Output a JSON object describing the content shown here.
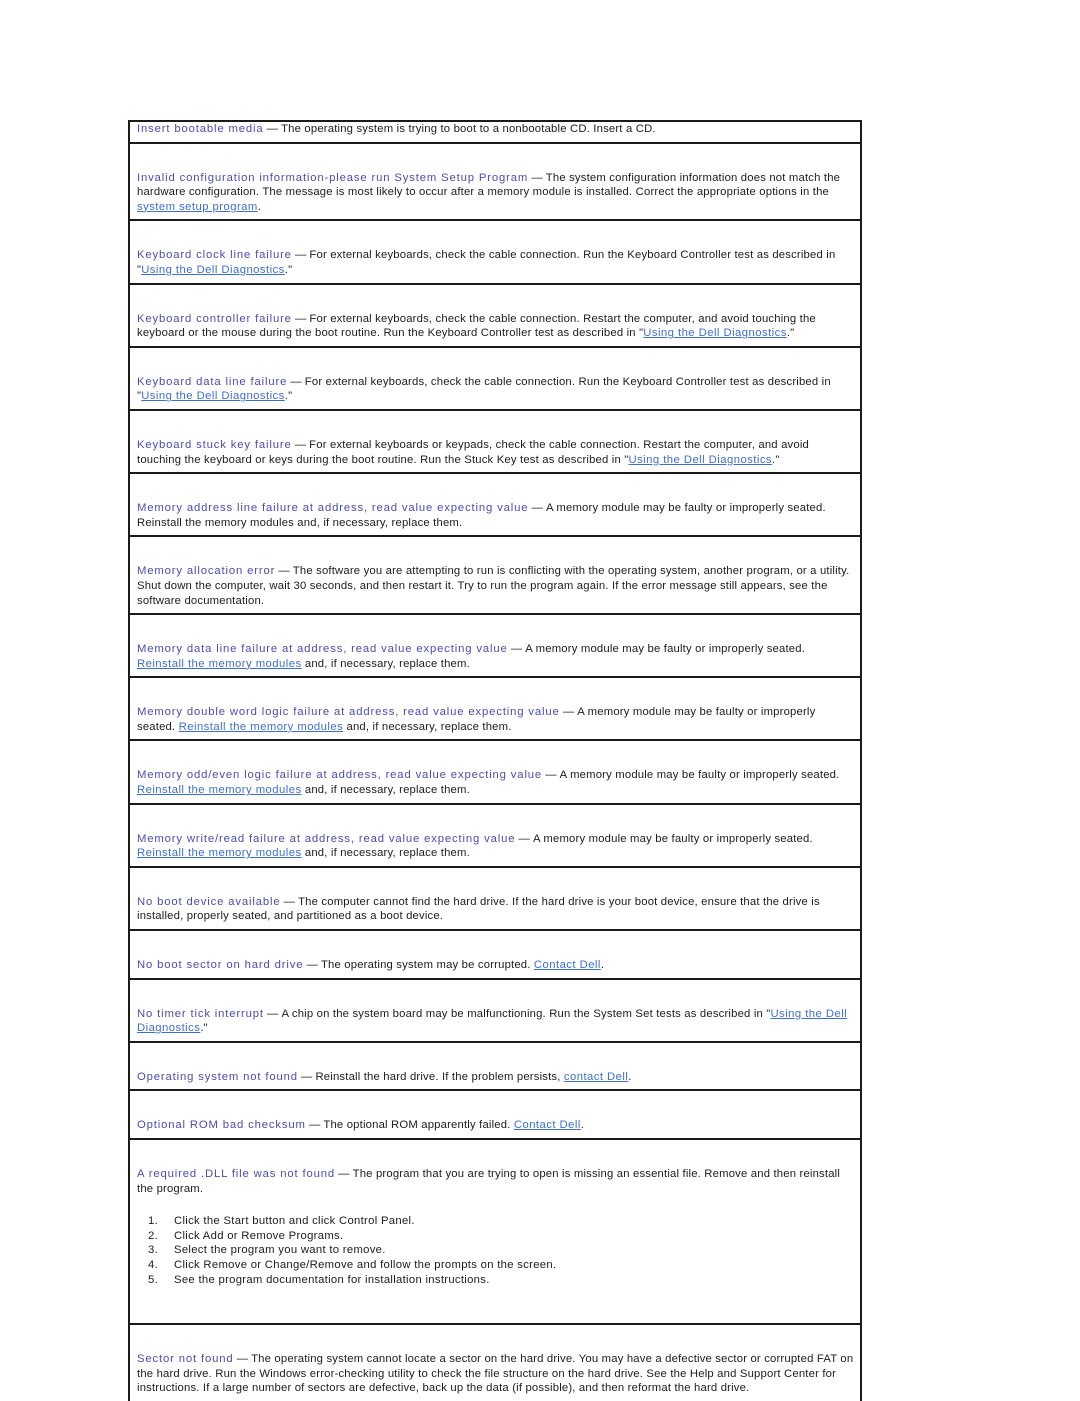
{
  "document": {
    "type": "error-messages-reference-table",
    "page_background": "#ffffff",
    "term_color": "#4b4bb4",
    "link_color": "#3d6ed0",
    "body_color": "#1c1c1c",
    "border_color": "#1a1a1a"
  },
  "rows": [
    {
      "term": "Insert bootable media",
      "dash": " — ",
      "body": "The operating system is trying to boot to a nonbootable CD. Insert a CD.",
      "links": []
    },
    {
      "term": "Invalid configuration information-please run System Setup Program",
      "dash": " — ",
      "body_part1": "The system configuration information does not match the hardware configuration. The message is most likely to occur after a memory module is installed. Correct the appropriate options in the ",
      "link1": "system setup program",
      "body_part2": "."
    },
    {
      "term": "Keyboard clock line failure",
      "dash": " — ",
      "body_part1": "For external keyboards, check the cable connection. Run the Keyboard Controller test as described in \"",
      "link1": "Using the Dell Diagnostics",
      "body_part2": ".\""
    },
    {
      "term": "Keyboard controller failure",
      "dash": " — ",
      "body_part1": "For external keyboards, check the cable connection. Restart the computer, and avoid touching the keyboard or the mouse during the boot routine. Run the Keyboard Controller test as described in \"",
      "link1": "Using the Dell Diagnostics",
      "body_part2": ".\""
    },
    {
      "term": "Keyboard data line failure",
      "dash": " — ",
      "body_part1": "For external keyboards, check the cable connection. Run the Keyboard Controller test as described in \"",
      "link1": "Using the Dell Diagnostics",
      "body_part2": ".\""
    },
    {
      "term": "Keyboard stuck key failure",
      "dash": " — ",
      "body_part1": "For external keyboards or keypads, check the cable connection. Restart the computer, and avoid touching the keyboard or keys during the boot routine. Run the Stuck Key test as described in \"",
      "link1": "Using the Dell Diagnostics",
      "body_part2": ".\""
    },
    {
      "term": "Memory address line failure at address, read value expecting value",
      "dash": " — ",
      "body": "A memory module may be faulty or improperly seated. Reinstall the memory modules and, if necessary, replace them.",
      "links": []
    },
    {
      "term": "Memory allocation error",
      "dash": " — ",
      "body": "The software you are attempting to run is conflicting with the operating system, another program, or a utility. Shut down the computer, wait 30 seconds, and then restart it. Try to run the program again. If the error message still appears, see the software documentation.",
      "links": []
    },
    {
      "term": "Memory data line failure at address, read value expecting value",
      "dash": " — ",
      "body_part1": "A memory module may be faulty or improperly seated. ",
      "link1": "Reinstall the memory modules",
      "body_part2": " and, if necessary, replace them."
    },
    {
      "term": "Memory double word logic failure at address, read value expecting value",
      "dash": " — ",
      "body_part1": "A memory module may be faulty or improperly seated. ",
      "link1": "Reinstall the memory modules",
      "body_part2": " and, if necessary, replace them."
    },
    {
      "term": "Memory odd/even logic failure at address, read value expecting value",
      "dash": " — ",
      "body_part1": "A memory module may be faulty or improperly seated. ",
      "link1": "Reinstall the memory modules",
      "body_part2": " and, if necessary, replace them."
    },
    {
      "term": "Memory write/read failure at address, read value expecting value",
      "dash": " — ",
      "body_part1": "A memory module may be faulty or improperly seated. ",
      "link1": "Reinstall the memory modules",
      "body_part2": " and, if necessary, replace them."
    },
    {
      "term": "No boot device available",
      "dash": " — ",
      "body": "The computer cannot find the hard drive. If the hard drive is your boot device, ensure that the drive is installed, properly seated, and partitioned as a boot device.",
      "links": []
    },
    {
      "term": "No boot sector on hard drive",
      "dash": " — ",
      "body_part1": "The operating system may be corrupted. ",
      "link1": "Contact Dell",
      "body_part2": "."
    },
    {
      "term": "No timer tick interrupt",
      "dash": " — ",
      "body_part1": "A chip on the system board may be malfunctioning. Run the System Set tests as described in \"",
      "link1": "Using the Dell Diagnostics",
      "body_part2": ".\""
    },
    {
      "term": "Operating system not found",
      "dash": " — ",
      "body_part1": "Reinstall the hard drive. If the problem persists, ",
      "link1": "contact Dell",
      "body_part2": "."
    },
    {
      "term": "Optional ROM bad checksum",
      "dash": " — ",
      "body_part1": "The optional ROM apparently failed. ",
      "link1": "Contact Dell",
      "body_part2": "."
    },
    {
      "term": "A required .DLL file was not found",
      "dash": " — ",
      "body": "The program that you are trying to open is missing an essential file. Remove and then reinstall the program.",
      "steps": [
        {
          "num": "1.",
          "text": "Click the Start button and click Control Panel."
        },
        {
          "num": "2.",
          "text": "Click Add or Remove Programs."
        },
        {
          "num": "3.",
          "text": "Select the program you want to remove."
        },
        {
          "num": "4.",
          "text": "Click Remove or Change/Remove and follow the prompts on the screen."
        },
        {
          "num": "5.",
          "text": "See the program documentation for installation instructions."
        }
      ]
    },
    {
      "term": "Sector not found",
      "dash": " — ",
      "body": "The operating system cannot locate a sector on the hard drive. You may have a defective sector or corrupted FAT on the hard drive. Run the Windows error-checking utility to check the file structure on the hard drive. See the Help and Support Center for instructions. If a large number of sectors are defective, back up the data (if possible), and then reformat the hard drive.",
      "links": []
    }
  ]
}
